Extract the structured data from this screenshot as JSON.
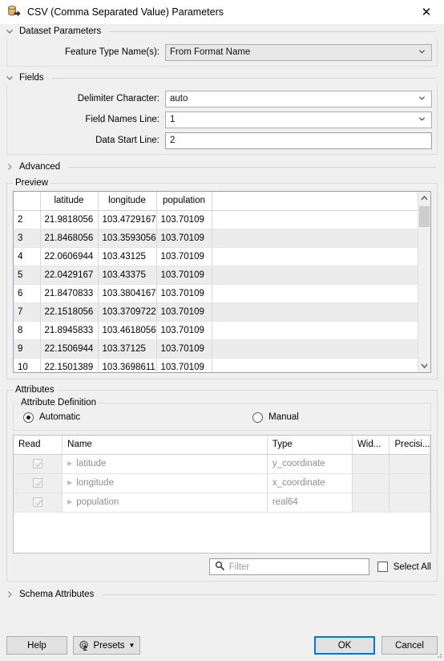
{
  "window": {
    "title": "CSV (Comma Separated Value) Parameters",
    "icon": "csv-reader-icon",
    "close_label": "✕"
  },
  "sections": {
    "dataset_parameters": {
      "label": "Dataset Parameters",
      "expanded": true,
      "chevron": "chevron-down"
    },
    "fields": {
      "label": "Fields",
      "expanded": true,
      "chevron": "chevron-down"
    },
    "advanced": {
      "label": "Advanced",
      "expanded": false,
      "chevron": "chevron-right"
    },
    "preview": {
      "label": "Preview"
    },
    "attributes": {
      "label": "Attributes"
    },
    "attribute_definition": {
      "label": "Attribute Definition"
    },
    "schema_attributes": {
      "label": "Schema Attributes",
      "expanded": false,
      "chevron": "chevron-right"
    }
  },
  "dataset_parameters": {
    "feature_type_names": {
      "label": "Feature Type Name(s):",
      "value": "From Format Name",
      "control": "combobox",
      "disabled": true
    }
  },
  "fields": {
    "delimiter_character": {
      "label": "Delimiter Character:",
      "value": "auto",
      "control": "combobox"
    },
    "field_names_line": {
      "label": "Field Names Line:",
      "value": "1",
      "control": "combobox"
    },
    "data_start_line": {
      "label": "Data Start Line:",
      "value": "2",
      "control": "textbox"
    }
  },
  "preview_table": {
    "columns": [
      "",
      "latitude",
      "longitude",
      "population"
    ],
    "rows": [
      {
        "index": "2",
        "latitude": "21.9818056",
        "longitude": "103.4729167",
        "population": "103.70109"
      },
      {
        "index": "3",
        "latitude": "21.8468056",
        "longitude": "103.3593056",
        "population": "103.70109"
      },
      {
        "index": "4",
        "latitude": "22.0606944",
        "longitude": "103.43125",
        "population": "103.70109"
      },
      {
        "index": "5",
        "latitude": "22.0429167",
        "longitude": "103.43375",
        "population": "103.70109"
      },
      {
        "index": "6",
        "latitude": "21.8470833",
        "longitude": "103.3804167",
        "population": "103.70109"
      },
      {
        "index": "7",
        "latitude": "22.1518056",
        "longitude": "103.3709722",
        "population": "103.70109"
      },
      {
        "index": "8",
        "latitude": "21.8945833",
        "longitude": "103.4618056",
        "population": "103.70109"
      },
      {
        "index": "9",
        "latitude": "22.1506944",
        "longitude": "103.37125",
        "population": "103.70109"
      },
      {
        "index": "10",
        "latitude": "22.1501389",
        "longitude": "103.3698611",
        "population": "103.70109"
      }
    ]
  },
  "attribute_definition": {
    "automatic": {
      "label": "Automatic",
      "selected": true
    },
    "manual": {
      "label": "Manual",
      "selected": false
    }
  },
  "attributes_table": {
    "columns": [
      "Read",
      "Name",
      "Type",
      "Wid...",
      "Precisi..."
    ],
    "rows": [
      {
        "read": true,
        "name": "latitude",
        "type": "y_coordinate",
        "width": "",
        "precision": ""
      },
      {
        "read": true,
        "name": "longitude",
        "type": "x_coordinate",
        "width": "",
        "precision": ""
      },
      {
        "read": true,
        "name": "population",
        "type": "real64",
        "width": "",
        "precision": ""
      }
    ]
  },
  "filter": {
    "placeholder": "Filter",
    "value": "",
    "icon": "search-icon"
  },
  "select_all": {
    "label": "Select All",
    "checked": false
  },
  "footer": {
    "help": "Help",
    "presets": "Presets",
    "presets_caret": "▼",
    "ok": "OK",
    "cancel": "Cancel"
  },
  "colors": {
    "accent": "#0078d7",
    "dialog_bg": "#f0f0f0",
    "alt_row": "#ececec",
    "disabled_text": "#8d8d8d"
  }
}
